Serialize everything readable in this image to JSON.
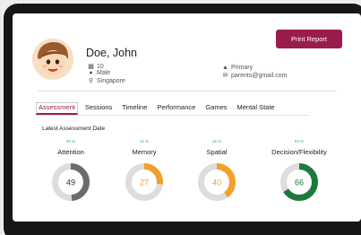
{
  "profile": {
    "name": "Doe, John",
    "age": "10",
    "gender": "Male",
    "location": "Singapore",
    "grade": "Primary",
    "email": "parents@gmail.com",
    "icons": {
      "age": "people-icon",
      "gender": "gender-icon",
      "location": "location-pin-icon",
      "grade": "graduation-cap-icon",
      "email": "envelope-icon"
    }
  },
  "actions": {
    "print_label": "Print Report"
  },
  "tabs": [
    {
      "label": "Assessment",
      "active": true
    },
    {
      "label": "Sessions",
      "active": false
    },
    {
      "label": "Timeline",
      "active": false
    },
    {
      "label": "Performance",
      "active": false
    },
    {
      "label": "Games",
      "active": false
    },
    {
      "label": "Mental State",
      "active": false
    }
  ],
  "assessment": {
    "title": "Latest Assessment Date",
    "metrics": [
      {
        "pct_label": "49 %",
        "label": "Attention",
        "value": 49,
        "color": "#6b6b6b"
      },
      {
        "pct_label": "11 %",
        "label": "Memory",
        "value": 27,
        "color": "#f0a02c"
      },
      {
        "pct_label": "16 %",
        "label": "Spatial",
        "value": 40,
        "color": "#f0a02c"
      },
      {
        "pct_label": "53 %",
        "label": "Decision/Flexibility",
        "value": 66,
        "color": "#1d7a3e"
      }
    ]
  },
  "colors": {
    "accent": "#9a1c4c",
    "track": "#dddddd",
    "pct_text": "#3aa3a0"
  }
}
